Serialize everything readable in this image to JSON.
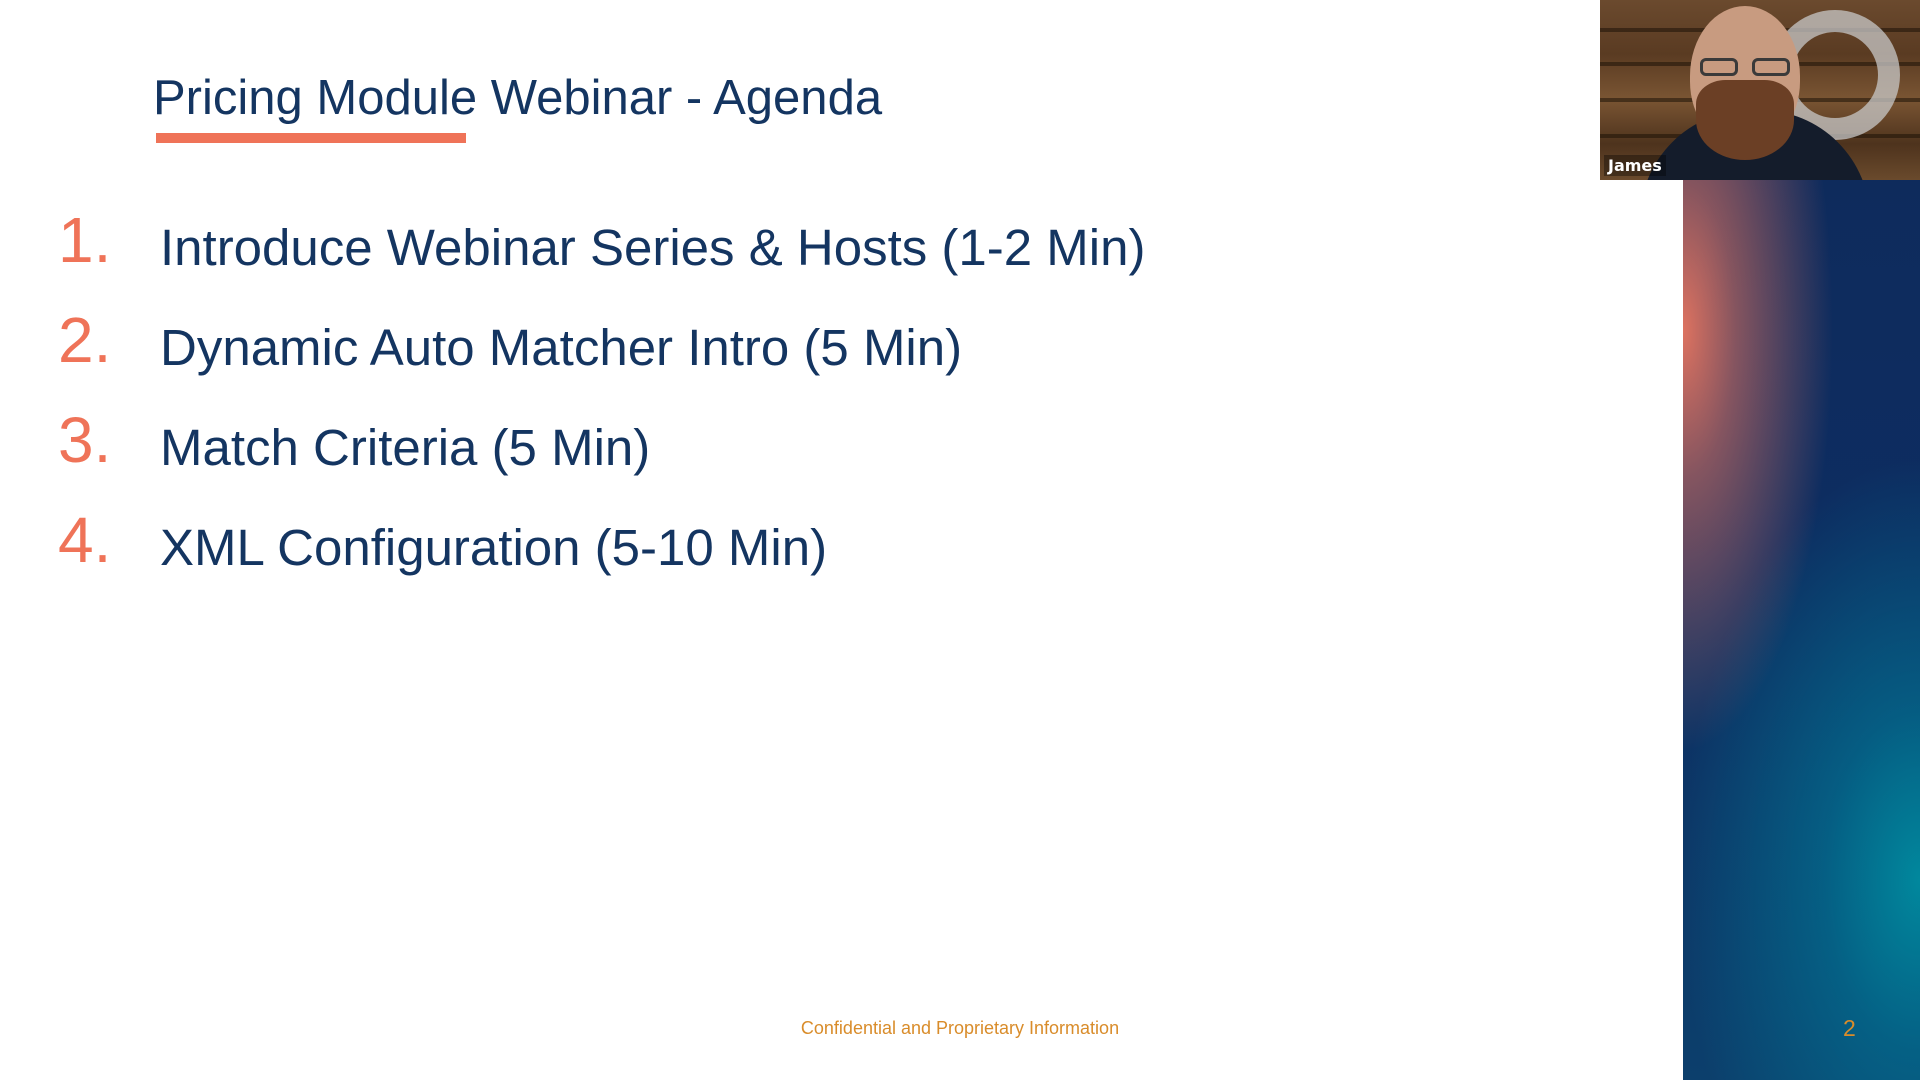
{
  "slide": {
    "title": "Pricing Module Webinar - Agenda",
    "agenda": [
      {
        "number": "1.",
        "text": "Introduce Webinar Series & Hosts (1-2 Min)"
      },
      {
        "number": "2.",
        "text": "Dynamic Auto Matcher Intro (5 Min)"
      },
      {
        "number": "3.",
        "text": "Match Criteria (5 Min)"
      },
      {
        "number": "4.",
        "text": "XML Configuration (5-10 Min)"
      }
    ],
    "footer": "Confidential and Proprietary Information",
    "page_number": "2"
  },
  "video": {
    "participant_name": "James"
  },
  "colors": {
    "title": "#143561",
    "accent": "#ef7358",
    "footer": "#d98c2a",
    "band_dark": "#0f2a5a"
  }
}
